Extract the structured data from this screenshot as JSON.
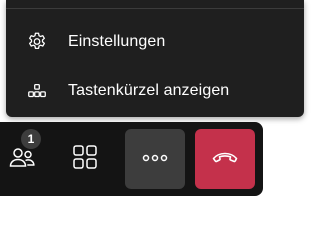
{
  "menu": {
    "items": [
      {
        "label": "Einstellungen",
        "icon": "gear-icon"
      },
      {
        "label": "Tastenkürzel anzeigen",
        "icon": "keyboard-shortcuts-icon"
      }
    ]
  },
  "toolbar": {
    "participants": {
      "icon": "people-icon",
      "badge_count": "1"
    },
    "view": {
      "icon": "grid-icon"
    },
    "more": {
      "icon": "more-dots-icon"
    },
    "hangup": {
      "icon": "hang-up-icon",
      "color": "#c4314b"
    }
  },
  "colors": {
    "menu_bg": "#1f1f1f",
    "toolbar_bg": "#141414",
    "more_button_bg": "#3d3d3d",
    "hangup_bg": "#c4314b"
  }
}
